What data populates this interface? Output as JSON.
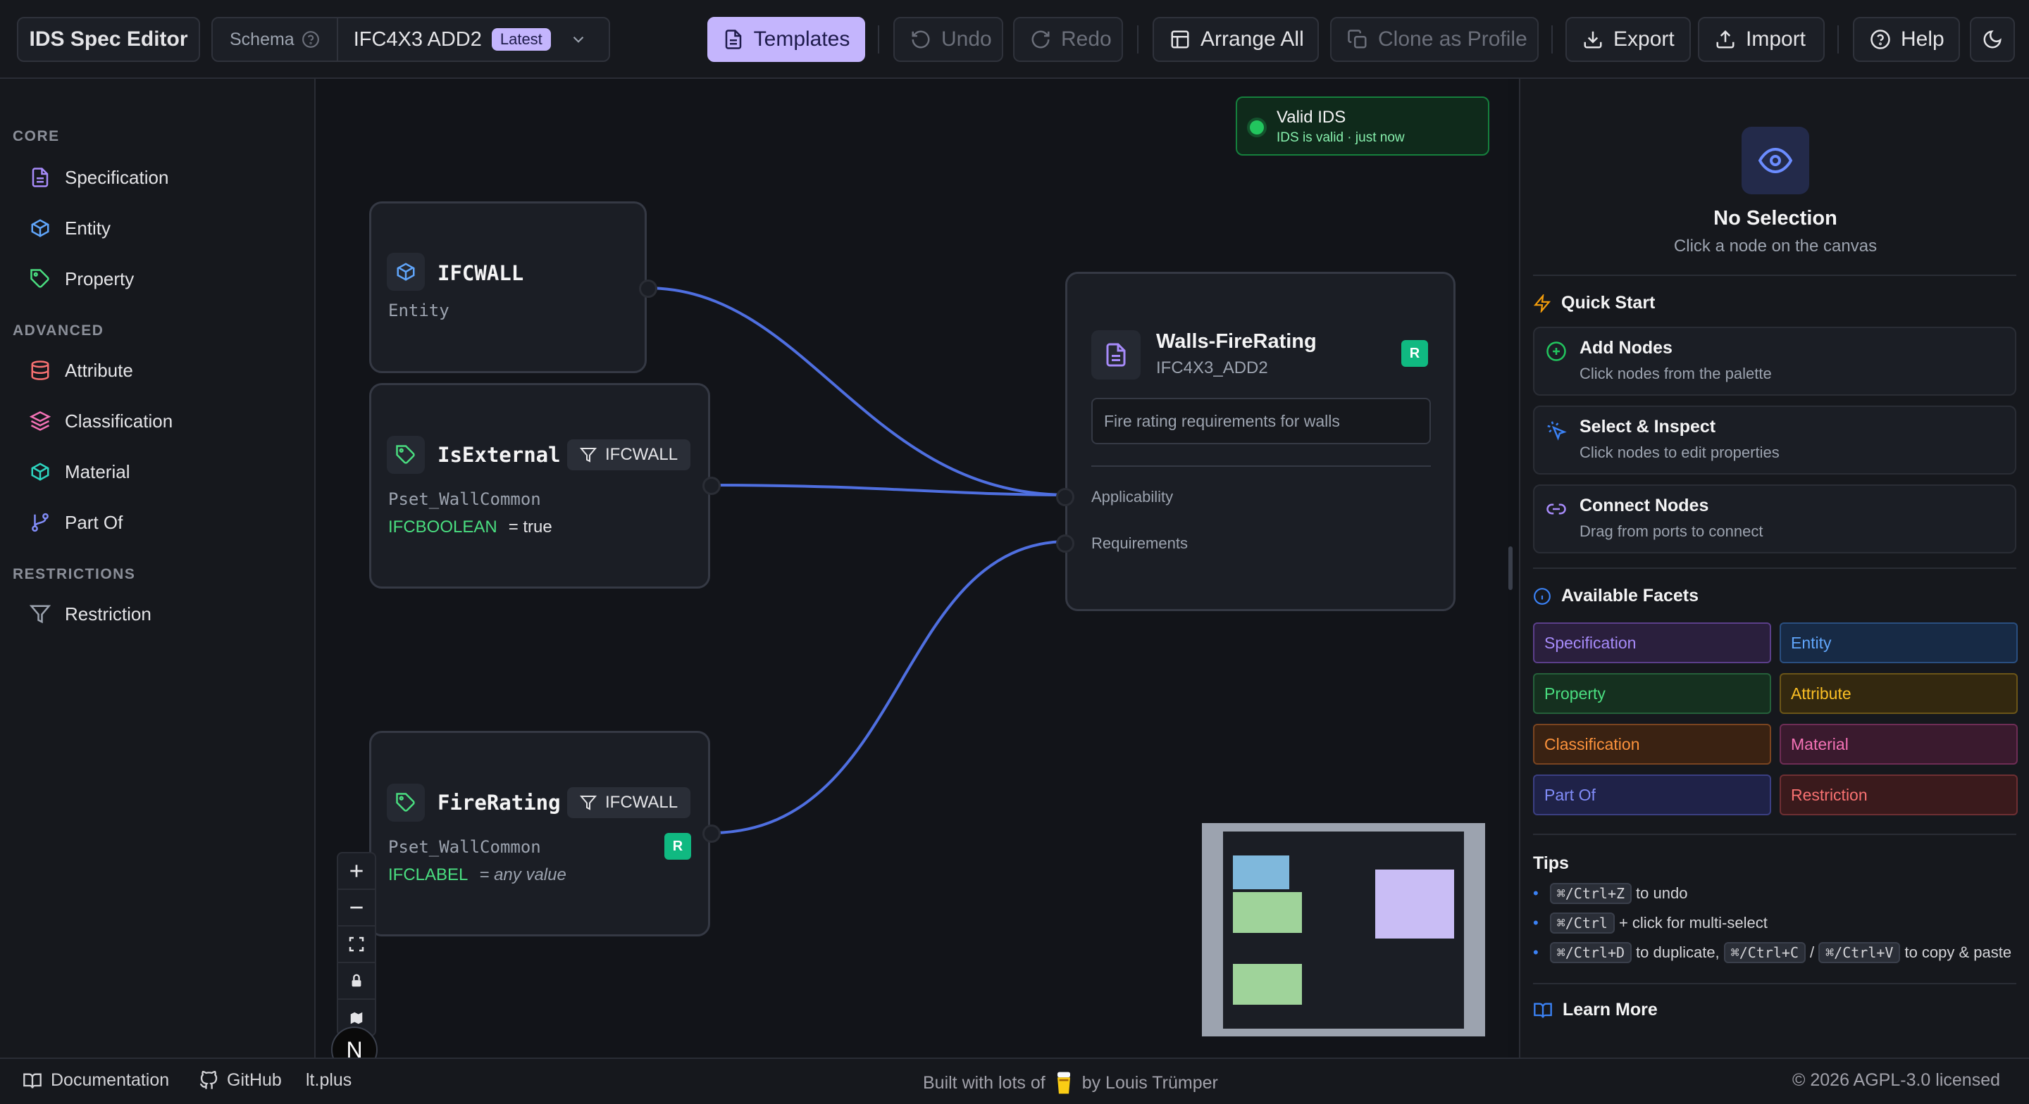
{
  "topbar": {
    "app_title": "IDS Spec Editor",
    "schema_label": "Schema",
    "schema_value": "IFC4X3 ADD2",
    "schema_badge": "Latest",
    "templates": "Templates",
    "undo": "Undo",
    "redo": "Redo",
    "arrange_all": "Arrange All",
    "clone_profile": "Clone as Profile",
    "export": "Export",
    "import": "Import",
    "help": "Help"
  },
  "sidebar": {
    "sections": [
      {
        "title": "CORE",
        "items": [
          {
            "label": "Specification",
            "color": "#a78bfa",
            "icon": "document-icon"
          },
          {
            "label": "Entity",
            "color": "#60a5fa",
            "icon": "cube-icon"
          },
          {
            "label": "Property",
            "color": "#4ade80",
            "icon": "tag-icon"
          }
        ]
      },
      {
        "title": "ADVANCED",
        "items": [
          {
            "label": "Attribute",
            "color": "#f87171",
            "icon": "database-icon"
          },
          {
            "label": "Classification",
            "color": "#f472b6",
            "icon": "layers-icon"
          },
          {
            "label": "Material",
            "color": "#2dd4bf",
            "icon": "box-icon"
          },
          {
            "label": "Part Of",
            "color": "#818cf8",
            "icon": "branch-icon"
          }
        ]
      },
      {
        "title": "RESTRICTIONS",
        "items": [
          {
            "label": "Restriction",
            "color": "#9ca3af",
            "icon": "filter-icon"
          }
        ]
      }
    ]
  },
  "canvas": {
    "status": {
      "title": "Valid IDS",
      "detail": "IDS is valid · just now"
    },
    "nodes": {
      "ifcwall": {
        "title": "IFCWALL",
        "subtitle": "Entity"
      },
      "isexternal": {
        "title": "IsExternal",
        "chip": "IFCWALL",
        "pset": "Pset_WallCommon",
        "datatype": "IFCBOOLEAN",
        "value": "= true"
      },
      "firerating": {
        "title": "FireRating",
        "chip": "IFCWALL",
        "pset": "Pset_WallCommon",
        "datatype": "IFCLABEL",
        "value": "= any value",
        "badge": "R"
      },
      "spec": {
        "title": "Walls-FireRating",
        "subtitle": "IFC4X3_ADD2",
        "description": "Fire rating requirements for walls",
        "badge": "R",
        "applicability": "Applicability",
        "requirements": "Requirements"
      }
    }
  },
  "right_panel": {
    "selection_title": "No Selection",
    "selection_hint": "Click a node on the canvas",
    "quick_start_title": "Quick Start",
    "quick_start": [
      {
        "title": "Add Nodes",
        "desc": "Click nodes from the palette",
        "icon": "plus-circle-icon"
      },
      {
        "title": "Select & Inspect",
        "desc": "Click nodes to edit properties",
        "icon": "pointer-icon"
      },
      {
        "title": "Connect Nodes",
        "desc": "Drag from ports to connect",
        "icon": "link-icon"
      }
    ],
    "facets_title": "Available Facets",
    "facets": [
      {
        "label": "Specification",
        "color": "#a78bfa",
        "bg": "#2a1f3d",
        "border": "#5b3f8a"
      },
      {
        "label": "Entity",
        "color": "#60a5fa",
        "bg": "#172a45",
        "border": "#2a4f80"
      },
      {
        "label": "Property",
        "color": "#4ade80",
        "bg": "#15301f",
        "border": "#25603a"
      },
      {
        "label": "Attribute",
        "color": "#fbbf24",
        "bg": "#33280f",
        "border": "#6b5518"
      },
      {
        "label": "Classification",
        "color": "#fb923c",
        "bg": "#3a2212",
        "border": "#7a4420"
      },
      {
        "label": "Material",
        "color": "#f472b6",
        "bg": "#3a1a2e",
        "border": "#6e2d55"
      },
      {
        "label": "Part Of",
        "color": "#818cf8",
        "bg": "#1f2248",
        "border": "#3b3f82"
      },
      {
        "label": "Restriction",
        "color": "#f87171",
        "bg": "#3a1a1c",
        "border": "#6e2f33"
      }
    ],
    "tips_title": "Tips",
    "tips": [
      {
        "keys": [
          "⌘/Ctrl+Z"
        ],
        "text": "to undo"
      },
      {
        "keys": [
          "⌘/Ctrl"
        ],
        "text": "+ click for multi-select"
      },
      {
        "keys": [
          "⌘/Ctrl+D"
        ],
        "text": "to duplicate,",
        "keys2": [
          "⌘/Ctrl+C",
          "⌘/Ctrl+V"
        ],
        "text2": "to copy & paste"
      }
    ],
    "learn_more": "Learn More"
  },
  "footer": {
    "documentation": "Documentation",
    "github": "GitHub",
    "site": "lt.plus",
    "built_prefix": "Built with lots of",
    "built_suffix": "by Louis Trümper",
    "license": "© 2026 AGPL-3.0 licensed",
    "avatar_letter": "N"
  }
}
